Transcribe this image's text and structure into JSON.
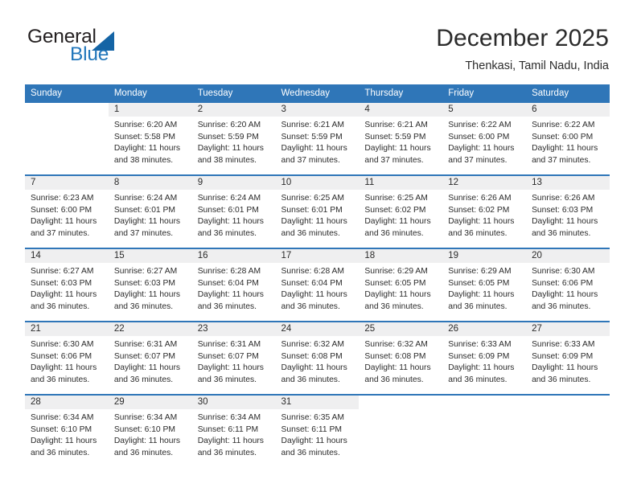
{
  "brand": {
    "word1": "General",
    "word2": "Blue",
    "triangle_color": "#1464a5",
    "blue_color": "#2277bb"
  },
  "header": {
    "title": "December 2025",
    "subtitle": "Thenkasi, Tamil Nadu, India"
  },
  "theme": {
    "header_blue": "#2f76b8",
    "daynum_gray": "#efeff0",
    "text": "#2b2b2b"
  },
  "weekdays": [
    "Sunday",
    "Monday",
    "Tuesday",
    "Wednesday",
    "Thursday",
    "Friday",
    "Saturday"
  ],
  "labels": {
    "sunrise_prefix": "Sunrise: ",
    "sunset_prefix": "Sunset: ",
    "daylight_prefix": "Daylight: "
  },
  "weeks": [
    [
      {
        "blank": true
      },
      {
        "day": "1",
        "sunrise": "Sunrise: 6:20 AM",
        "sunset": "Sunset: 5:58 PM",
        "daylight1": "Daylight: 11 hours",
        "daylight2": "and 38 minutes."
      },
      {
        "day": "2",
        "sunrise": "Sunrise: 6:20 AM",
        "sunset": "Sunset: 5:59 PM",
        "daylight1": "Daylight: 11 hours",
        "daylight2": "and 38 minutes."
      },
      {
        "day": "3",
        "sunrise": "Sunrise: 6:21 AM",
        "sunset": "Sunset: 5:59 PM",
        "daylight1": "Daylight: 11 hours",
        "daylight2": "and 37 minutes."
      },
      {
        "day": "4",
        "sunrise": "Sunrise: 6:21 AM",
        "sunset": "Sunset: 5:59 PM",
        "daylight1": "Daylight: 11 hours",
        "daylight2": "and 37 minutes."
      },
      {
        "day": "5",
        "sunrise": "Sunrise: 6:22 AM",
        "sunset": "Sunset: 6:00 PM",
        "daylight1": "Daylight: 11 hours",
        "daylight2": "and 37 minutes."
      },
      {
        "day": "6",
        "sunrise": "Sunrise: 6:22 AM",
        "sunset": "Sunset: 6:00 PM",
        "daylight1": "Daylight: 11 hours",
        "daylight2": "and 37 minutes."
      }
    ],
    [
      {
        "day": "7",
        "sunrise": "Sunrise: 6:23 AM",
        "sunset": "Sunset: 6:00 PM",
        "daylight1": "Daylight: 11 hours",
        "daylight2": "and 37 minutes."
      },
      {
        "day": "8",
        "sunrise": "Sunrise: 6:24 AM",
        "sunset": "Sunset: 6:01 PM",
        "daylight1": "Daylight: 11 hours",
        "daylight2": "and 37 minutes."
      },
      {
        "day": "9",
        "sunrise": "Sunrise: 6:24 AM",
        "sunset": "Sunset: 6:01 PM",
        "daylight1": "Daylight: 11 hours",
        "daylight2": "and 36 minutes."
      },
      {
        "day": "10",
        "sunrise": "Sunrise: 6:25 AM",
        "sunset": "Sunset: 6:01 PM",
        "daylight1": "Daylight: 11 hours",
        "daylight2": "and 36 minutes."
      },
      {
        "day": "11",
        "sunrise": "Sunrise: 6:25 AM",
        "sunset": "Sunset: 6:02 PM",
        "daylight1": "Daylight: 11 hours",
        "daylight2": "and 36 minutes."
      },
      {
        "day": "12",
        "sunrise": "Sunrise: 6:26 AM",
        "sunset": "Sunset: 6:02 PM",
        "daylight1": "Daylight: 11 hours",
        "daylight2": "and 36 minutes."
      },
      {
        "day": "13",
        "sunrise": "Sunrise: 6:26 AM",
        "sunset": "Sunset: 6:03 PM",
        "daylight1": "Daylight: 11 hours",
        "daylight2": "and 36 minutes."
      }
    ],
    [
      {
        "day": "14",
        "sunrise": "Sunrise: 6:27 AM",
        "sunset": "Sunset: 6:03 PM",
        "daylight1": "Daylight: 11 hours",
        "daylight2": "and 36 minutes."
      },
      {
        "day": "15",
        "sunrise": "Sunrise: 6:27 AM",
        "sunset": "Sunset: 6:03 PM",
        "daylight1": "Daylight: 11 hours",
        "daylight2": "and 36 minutes."
      },
      {
        "day": "16",
        "sunrise": "Sunrise: 6:28 AM",
        "sunset": "Sunset: 6:04 PM",
        "daylight1": "Daylight: 11 hours",
        "daylight2": "and 36 minutes."
      },
      {
        "day": "17",
        "sunrise": "Sunrise: 6:28 AM",
        "sunset": "Sunset: 6:04 PM",
        "daylight1": "Daylight: 11 hours",
        "daylight2": "and 36 minutes."
      },
      {
        "day": "18",
        "sunrise": "Sunrise: 6:29 AM",
        "sunset": "Sunset: 6:05 PM",
        "daylight1": "Daylight: 11 hours",
        "daylight2": "and 36 minutes."
      },
      {
        "day": "19",
        "sunrise": "Sunrise: 6:29 AM",
        "sunset": "Sunset: 6:05 PM",
        "daylight1": "Daylight: 11 hours",
        "daylight2": "and 36 minutes."
      },
      {
        "day": "20",
        "sunrise": "Sunrise: 6:30 AM",
        "sunset": "Sunset: 6:06 PM",
        "daylight1": "Daylight: 11 hours",
        "daylight2": "and 36 minutes."
      }
    ],
    [
      {
        "day": "21",
        "sunrise": "Sunrise: 6:30 AM",
        "sunset": "Sunset: 6:06 PM",
        "daylight1": "Daylight: 11 hours",
        "daylight2": "and 36 minutes."
      },
      {
        "day": "22",
        "sunrise": "Sunrise: 6:31 AM",
        "sunset": "Sunset: 6:07 PM",
        "daylight1": "Daylight: 11 hours",
        "daylight2": "and 36 minutes."
      },
      {
        "day": "23",
        "sunrise": "Sunrise: 6:31 AM",
        "sunset": "Sunset: 6:07 PM",
        "daylight1": "Daylight: 11 hours",
        "daylight2": "and 36 minutes."
      },
      {
        "day": "24",
        "sunrise": "Sunrise: 6:32 AM",
        "sunset": "Sunset: 6:08 PM",
        "daylight1": "Daylight: 11 hours",
        "daylight2": "and 36 minutes."
      },
      {
        "day": "25",
        "sunrise": "Sunrise: 6:32 AM",
        "sunset": "Sunset: 6:08 PM",
        "daylight1": "Daylight: 11 hours",
        "daylight2": "and 36 minutes."
      },
      {
        "day": "26",
        "sunrise": "Sunrise: 6:33 AM",
        "sunset": "Sunset: 6:09 PM",
        "daylight1": "Daylight: 11 hours",
        "daylight2": "and 36 minutes."
      },
      {
        "day": "27",
        "sunrise": "Sunrise: 6:33 AM",
        "sunset": "Sunset: 6:09 PM",
        "daylight1": "Daylight: 11 hours",
        "daylight2": "and 36 minutes."
      }
    ],
    [
      {
        "day": "28",
        "sunrise": "Sunrise: 6:34 AM",
        "sunset": "Sunset: 6:10 PM",
        "daylight1": "Daylight: 11 hours",
        "daylight2": "and 36 minutes."
      },
      {
        "day": "29",
        "sunrise": "Sunrise: 6:34 AM",
        "sunset": "Sunset: 6:10 PM",
        "daylight1": "Daylight: 11 hours",
        "daylight2": "and 36 minutes."
      },
      {
        "day": "30",
        "sunrise": "Sunrise: 6:34 AM",
        "sunset": "Sunset: 6:11 PM",
        "daylight1": "Daylight: 11 hours",
        "daylight2": "and 36 minutes."
      },
      {
        "day": "31",
        "sunrise": "Sunrise: 6:35 AM",
        "sunset": "Sunset: 6:11 PM",
        "daylight1": "Daylight: 11 hours",
        "daylight2": "and 36 minutes."
      },
      {
        "blank": true
      },
      {
        "blank": true
      },
      {
        "blank": true
      }
    ]
  ]
}
